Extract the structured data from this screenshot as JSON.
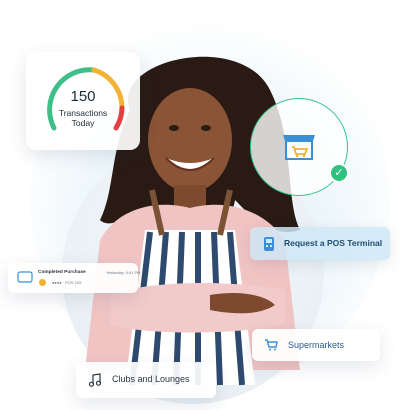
{
  "gauge": {
    "value": "150",
    "label_line1": "Transactions",
    "label_line2": "Today",
    "colors": [
      "#3fbf88",
      "#f2b233",
      "#e34040"
    ]
  },
  "pos_terminal": {
    "label": "Request a POS Terminal"
  },
  "purchase": {
    "title": "Completed Purchase",
    "time": "Yesterday, 9:41 PM",
    "subtitle": "●●●● · POS 105"
  },
  "categories": {
    "supermarkets": "Supermarkets",
    "clubs": "Clubs and Lounges"
  },
  "colors": {
    "accent_green": "#2ec27e",
    "accent_blue": "#3a8fd6",
    "card_blue": "#cfe8f6"
  },
  "icons": {
    "store": "store-cart-icon",
    "check": "checkmark-icon",
    "pos": "pos-terminal-icon",
    "card": "card-icon",
    "cart": "shopping-cart-icon",
    "music": "music-note-icon"
  }
}
